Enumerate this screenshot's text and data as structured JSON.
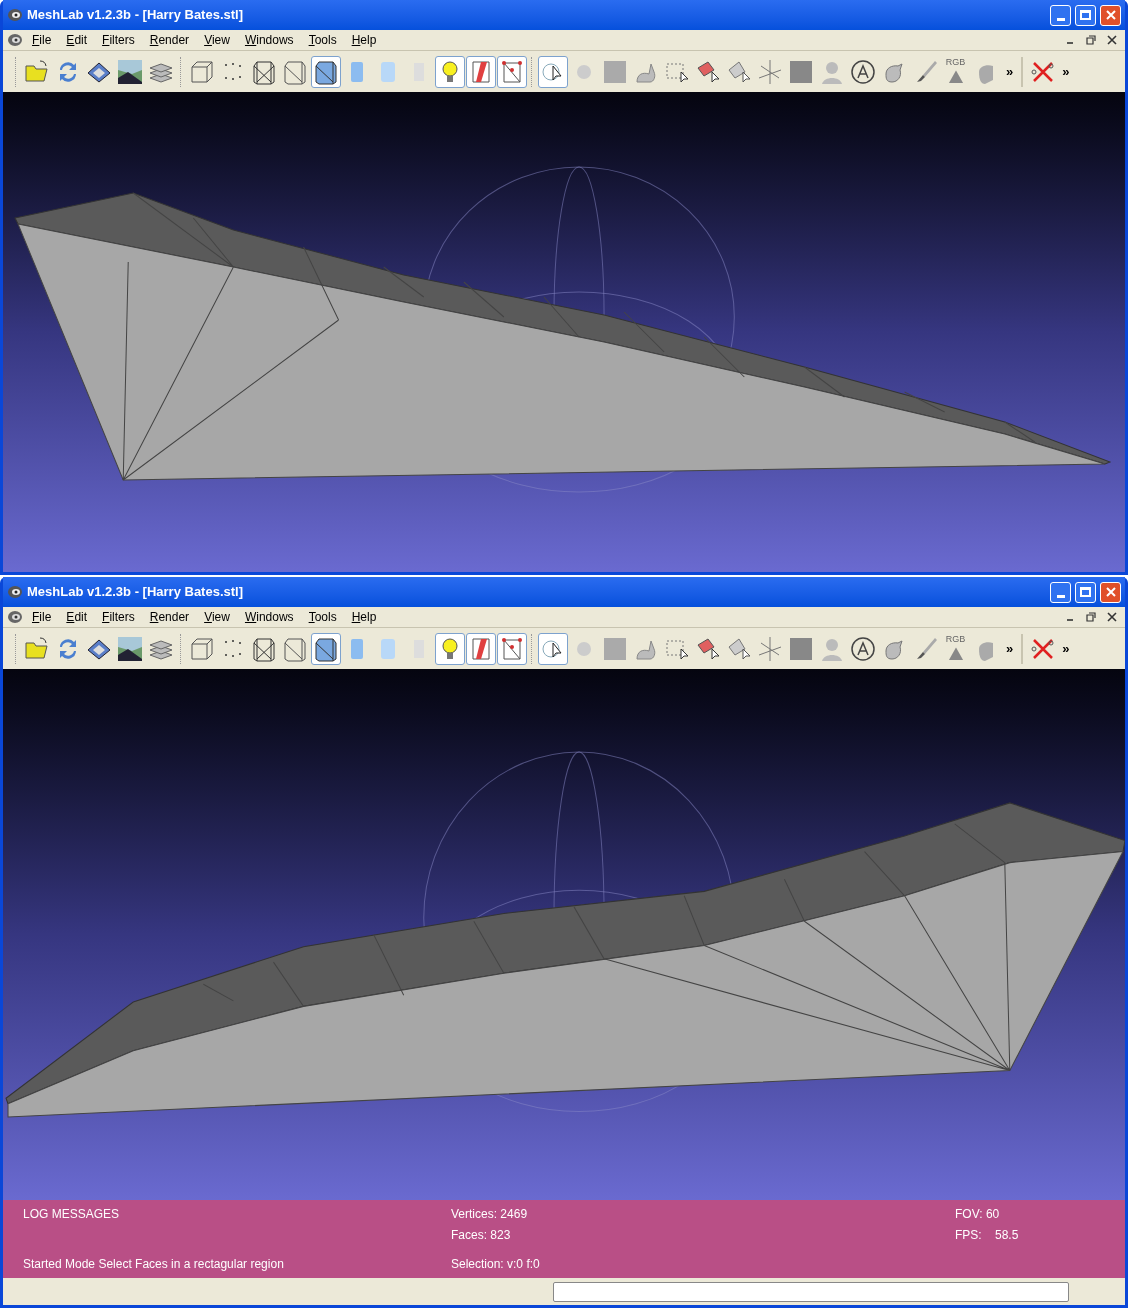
{
  "windows": [
    {
      "title": "MeshLab v1.2.3b - [Harry Bates.stl]",
      "menu": [
        "File",
        "Edit",
        "Filters",
        "Render",
        "View",
        "Windows",
        "Tools",
        "Help"
      ],
      "toolbar": {
        "buttons": [
          {
            "selected": false
          },
          {
            "selected": false
          },
          {
            "selected": false
          },
          {
            "selected": false
          },
          {
            "selected": false
          },
          {
            "selected": false
          },
          {
            "selected": false
          },
          {
            "selected": false
          },
          {
            "selected": false
          },
          {
            "selected": true
          },
          {
            "selected": false
          },
          {
            "selected": false
          },
          {
            "selected": false
          },
          {
            "selected": true
          },
          {
            "selected": true
          },
          {
            "selected": true
          },
          {
            "selected": true
          },
          {
            "selected": false
          },
          {
            "selected": false
          },
          {
            "selected": false
          },
          {
            "selected": false
          },
          {
            "selected": false
          },
          {
            "selected": false
          },
          {
            "selected": false
          },
          {
            "selected": false
          },
          {
            "selected": false
          },
          {
            "selected": false
          },
          {
            "selected": false
          },
          {
            "selected": false
          },
          {
            "selected": false
          },
          {
            "selected": false
          },
          {
            "selected": false
          }
        ],
        "rgb_label": "RGB",
        "overflow": [
          "»",
          "»"
        ]
      },
      "view": {
        "kind": "right"
      }
    },
    {
      "title": "MeshLab v1.2.3b - [Harry Bates.stl]",
      "menu": [
        "File",
        "Edit",
        "Filters",
        "Render",
        "View",
        "Windows",
        "Tools",
        "Help"
      ],
      "toolbar": {
        "buttons": [
          {
            "selected": false
          },
          {
            "selected": false
          },
          {
            "selected": false
          },
          {
            "selected": false
          },
          {
            "selected": false
          },
          {
            "selected": false
          },
          {
            "selected": false
          },
          {
            "selected": false
          },
          {
            "selected": false
          },
          {
            "selected": true
          },
          {
            "selected": false
          },
          {
            "selected": false
          },
          {
            "selected": false
          },
          {
            "selected": true
          },
          {
            "selected": true
          },
          {
            "selected": true
          },
          {
            "selected": true
          },
          {
            "selected": false
          },
          {
            "selected": false
          },
          {
            "selected": false
          },
          {
            "selected": false
          },
          {
            "selected": false
          },
          {
            "selected": false
          },
          {
            "selected": false
          },
          {
            "selected": false
          },
          {
            "selected": false
          },
          {
            "selected": false
          },
          {
            "selected": false
          },
          {
            "selected": false
          },
          {
            "selected": false
          },
          {
            "selected": false
          },
          {
            "selected": false
          }
        ],
        "rgb_label": "RGB",
        "overflow": [
          "»",
          "»"
        ]
      },
      "view": {
        "kind": "left"
      },
      "info_panel": {
        "heading": "LOG MESSAGES",
        "message": "Started Mode Select Faces in a rectagular region",
        "vertices": "Vertices: 2469",
        "faces": "Faces: 823",
        "selection": "Selection: v:0 f:0",
        "fov": "FOV: 60",
        "fps": "FPS:    58.5"
      },
      "status_bar": {
        "progress": {
          "level": 0
        }
      }
    }
  ]
}
